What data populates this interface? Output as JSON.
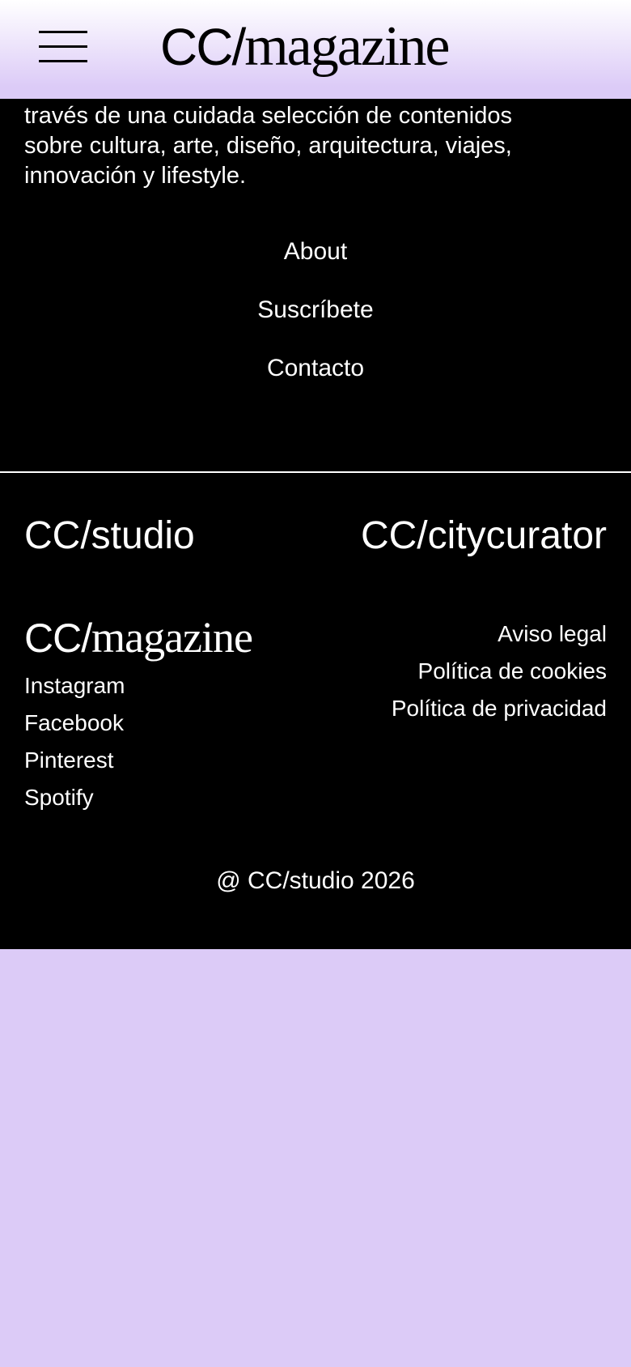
{
  "header": {
    "logo_prefix": "CC/",
    "logo_word": "magazine",
    "menu_icon": "hamburger-menu-icon"
  },
  "footer": {
    "intro_lines": [
      "través de una cuidada selección de contenidos",
      "sobre cultura, arte, diseño, arquitectura, viajes,",
      "innovación y lifestyle."
    ],
    "nav": [
      {
        "label": "About"
      },
      {
        "label": "Suscríbete"
      },
      {
        "label": "Contacto"
      }
    ],
    "brand_left": "CC/studio",
    "brand_right": "CC/citycurator",
    "mag_logo_prefix": "CC/",
    "mag_logo_word": "magazine",
    "social": [
      {
        "label": "Instagram"
      },
      {
        "label": "Facebook"
      },
      {
        "label": "Pinterest"
      },
      {
        "label": "Spotify"
      }
    ],
    "legal": [
      {
        "label": "Aviso legal"
      },
      {
        "label": "Política de cookies"
      },
      {
        "label": "Política de privacidad"
      }
    ],
    "copyright": "@ CC/studio 2026"
  },
  "colors": {
    "background": "#dccbf7",
    "footer_bg": "#000000",
    "text_light": "#ffffff",
    "text_dark": "#000000"
  }
}
